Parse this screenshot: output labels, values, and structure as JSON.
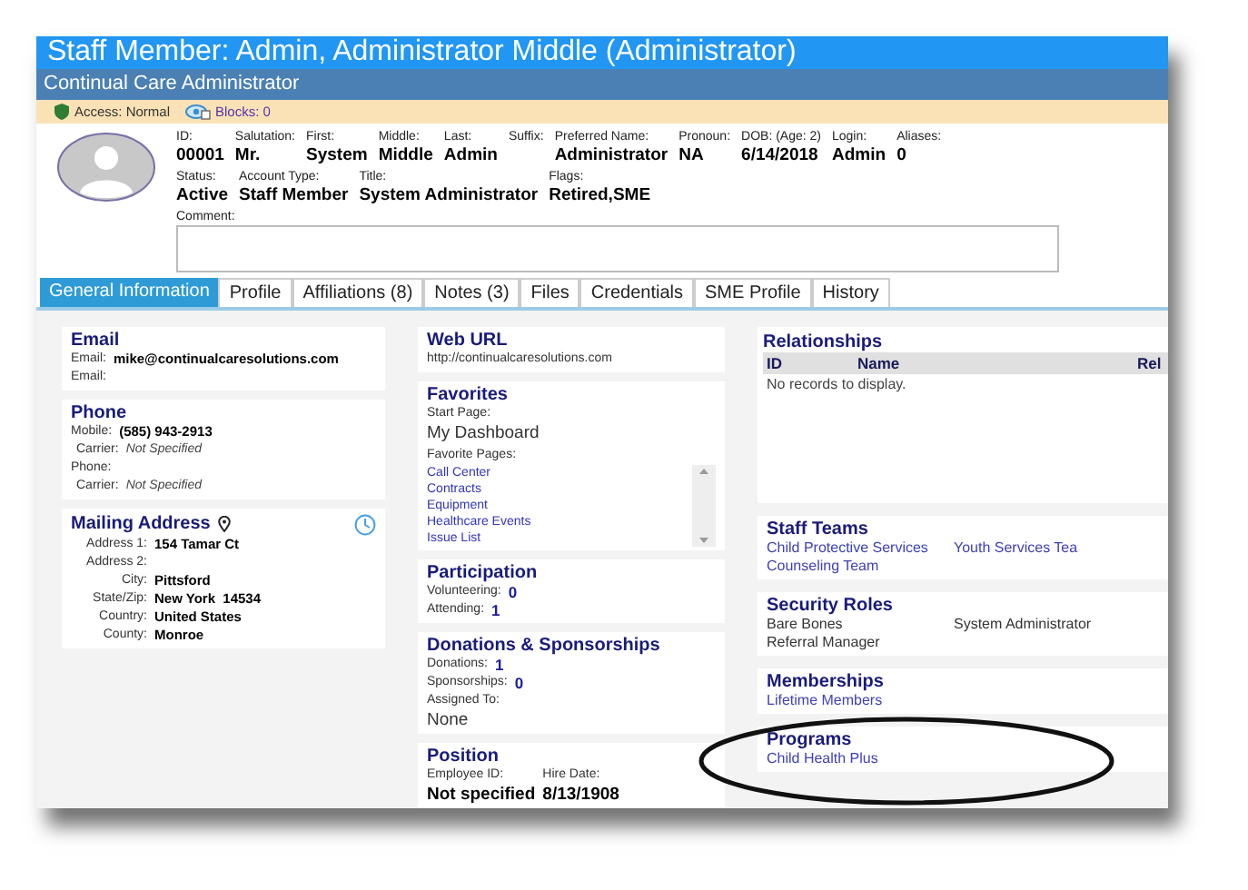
{
  "window": {
    "title": "Staff Member: Admin, Administrator Middle (Administrator)",
    "subtitle": "Continual Care Administrator"
  },
  "status_strip": {
    "access": "Access: Normal",
    "blocks": "Blocks: 0"
  },
  "header": {
    "row_1": [
      {
        "label": "ID:",
        "value": "00001"
      },
      {
        "label": "Salutation:",
        "value": "Mr."
      },
      {
        "label": "First:",
        "value": "System"
      },
      {
        "label": "Middle:",
        "value": "Middle"
      },
      {
        "label": "Last:",
        "value": "Admin"
      },
      {
        "label": "Suffix:"
      },
      {
        "label": "Preferred Name:",
        "value": "Administrator"
      },
      {
        "label": "Pronoun:",
        "value": "NA"
      },
      {
        "label": "DOB: (Age: 2)",
        "value": "6/14/2018"
      },
      {
        "label": "Login:",
        "value": "Admin"
      },
      {
        "label": "Aliases:",
        "value": "0"
      }
    ],
    "row_2": [
      {
        "label": "Status:",
        "value": "Active"
      },
      {
        "label": "Account Type:",
        "value": "Staff Member"
      },
      {
        "label": "Title:",
        "value": "System Administrator"
      },
      {
        "label": "Flags:",
        "value": "Retired,SME"
      }
    ],
    "comment_label": "Comment:"
  },
  "tabs": [
    {
      "label": "General Information",
      "selected": true
    },
    {
      "label": "Profile",
      "selected": false
    },
    {
      "label": "Affiliations (8)",
      "selected": false
    },
    {
      "label": "Notes (3)",
      "selected": false
    },
    {
      "label": "Files",
      "selected": false
    },
    {
      "label": "Credentials",
      "selected": false
    },
    {
      "label": "SME Profile",
      "selected": false
    },
    {
      "label": "History",
      "selected": false
    }
  ],
  "columns": [
    [
      {
        "kind": "fields",
        "title": "Email",
        "rows": [
          {
            "kind": "bold",
            "label": "Email:",
            "value": "mike@continualcaresolutions.com"
          },
          {
            "kind": "bold",
            "label": "Email:"
          }
        ]
      },
      {
        "kind": "fields",
        "title": "Phone",
        "rows": [
          {
            "kind": "bold",
            "label": "Mobile:",
            "value": "(585) 943-2913"
          },
          {
            "kind": "italic",
            "label": "Carrier:",
            "value": "Not Specified"
          },
          {
            "kind": "bold",
            "label": "Phone:"
          },
          {
            "kind": "italic",
            "label": "Carrier:",
            "value": "Not Specified"
          }
        ]
      },
      {
        "kind": "address",
        "title": "Mailing Address",
        "rows": [
          {
            "label": "Address 1:",
            "value": "154 Tamar Ct"
          },
          {
            "label": "Address 2:"
          },
          {
            "label": "City:",
            "value": "Pittsford"
          },
          {
            "label": "State/Zip:",
            "value": "New York  14534"
          },
          {
            "label": "Country:",
            "value": "United States"
          },
          {
            "label": "County:",
            "value": "Monroe"
          }
        ]
      }
    ],
    [
      {
        "kind": "text",
        "title": "Web URL",
        "lines": [
          "http://continualcaresolutions.com"
        ]
      },
      {
        "kind": "favorites",
        "title": "Favorites",
        "start_label": "Start Page:",
        "start_value": "My Dashboard",
        "pages_label": "Favorite Pages:",
        "pages": [
          "Call Center",
          "Contracts",
          "Equipment",
          "Healthcare Events",
          "Issue List"
        ]
      },
      {
        "kind": "fields",
        "title": "Participation",
        "rows": [
          {
            "kind": "count",
            "label": "Volunteering:",
            "value": "0"
          },
          {
            "kind": "count",
            "label": "Attending:",
            "value": "1"
          }
        ]
      },
      {
        "kind": "fields",
        "title": "Donations & Sponsorships",
        "rows": [
          {
            "kind": "count",
            "label": "Donations:",
            "value": "1"
          },
          {
            "kind": "count",
            "label": "Sponsorships:",
            "value": "0"
          },
          {
            "kind": "stacked",
            "label": "Assigned To:",
            "value": "None"
          }
        ]
      },
      {
        "kind": "columns",
        "title": "Position",
        "rows": [
          {
            "label": "Employee ID:",
            "value": "Not specified"
          },
          {
            "label": "Hire Date:",
            "value": "8/13/1908"
          }
        ]
      }
    ],
    [
      {
        "kind": "table",
        "title": "Relationships",
        "headers": [
          "ID",
          "Name",
          "Rel"
        ],
        "empty": "No records to display."
      },
      {
        "kind": "list",
        "title": "Staff Teams",
        "link": true,
        "items": [
          "Child Protective Services",
          "Youth Services Tea",
          "Counseling Team"
        ]
      },
      {
        "kind": "list",
        "title": "Security Roles",
        "link": false,
        "items": [
          "Bare Bones",
          "System Administrator",
          "Referral Manager"
        ]
      },
      {
        "kind": "list",
        "title": "Memberships",
        "link": true,
        "items": [
          "Lifetime Members"
        ]
      },
      {
        "kind": "list",
        "title": "Programs",
        "link": true,
        "items": [
          "Child Health Plus"
        ]
      }
    ]
  ]
}
